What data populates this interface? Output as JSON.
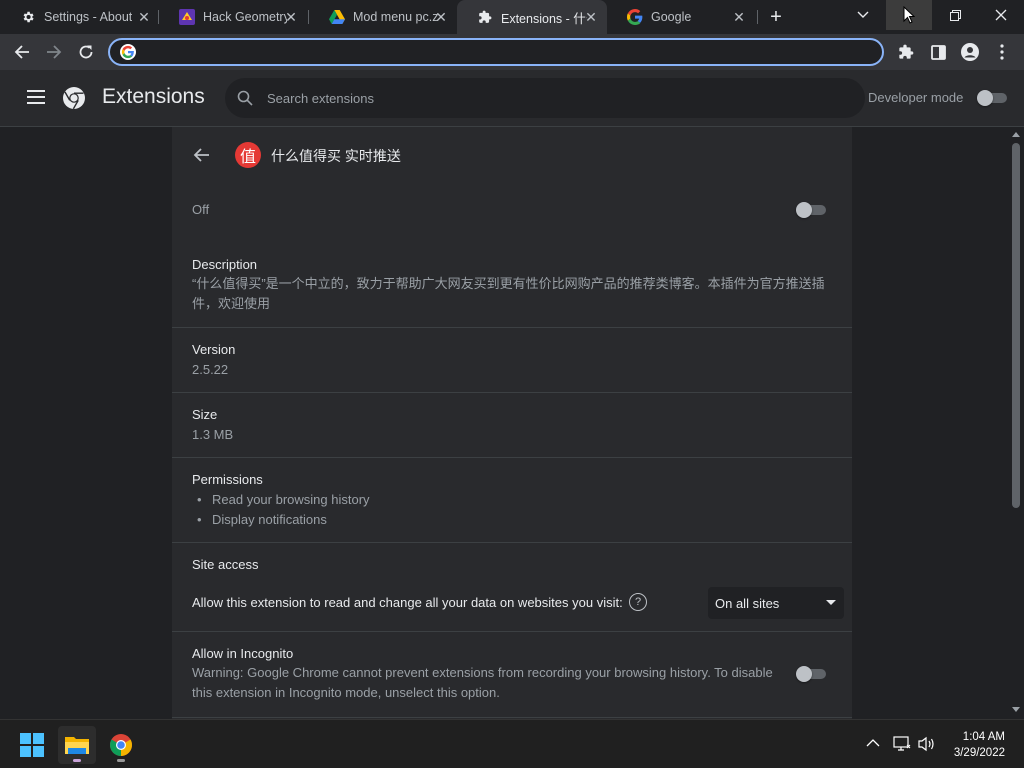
{
  "tabs": [
    {
      "title": "Settings - About",
      "icon": "gear-icon",
      "active": false
    },
    {
      "title": "Hack Geometry",
      "icon": "game-icon",
      "active": false
    },
    {
      "title": "Mod menu pc.z",
      "icon": "drive-icon",
      "active": false
    },
    {
      "title": "Extensions - 什么",
      "icon": "puzzle-icon",
      "active": true
    },
    {
      "title": "Google",
      "icon": "google-icon",
      "active": false
    }
  ],
  "toolbar": {
    "omnibox_value": ""
  },
  "header": {
    "title": "Extensions",
    "search_placeholder": "Search extensions",
    "developer_mode_label": "Developer mode",
    "developer_mode_on": false
  },
  "extension": {
    "name": "什么值得买 实时推送",
    "icon_glyph": "值",
    "icon_color": "#e53935",
    "enabled_label": "Off",
    "enabled": false,
    "description_label": "Description",
    "description_line1": "“什么值得买”是一个中立的，致力于帮助广大网友买到更有性价比网购产品的推荐类博客。本插件为官方推送插",
    "description_line2": "件，欢迎使用",
    "version_label": "Version",
    "version": "2.5.22",
    "size_label": "Size",
    "size": "1.3 MB",
    "permissions_label": "Permissions",
    "permissions": [
      "Read your browsing history",
      "Display notifications"
    ],
    "site_access_label": "Site access",
    "site_access_text": "Allow this extension to read and change all your data on websites you visit:",
    "site_access_value": "On all sites",
    "incognito_label": "Allow in Incognito",
    "incognito_line1": "Warning: Google Chrome cannot prevent extensions from recording your browsing history. To disable",
    "incognito_line2": "this extension in Incognito mode, unselect this option.",
    "incognito_enabled": false
  },
  "taskbar": {
    "time": "1:04 AM",
    "date": "3/29/2022"
  },
  "colors": {
    "accent": "#8ab4f8",
    "background": "#202124",
    "card": "#292a2d"
  }
}
